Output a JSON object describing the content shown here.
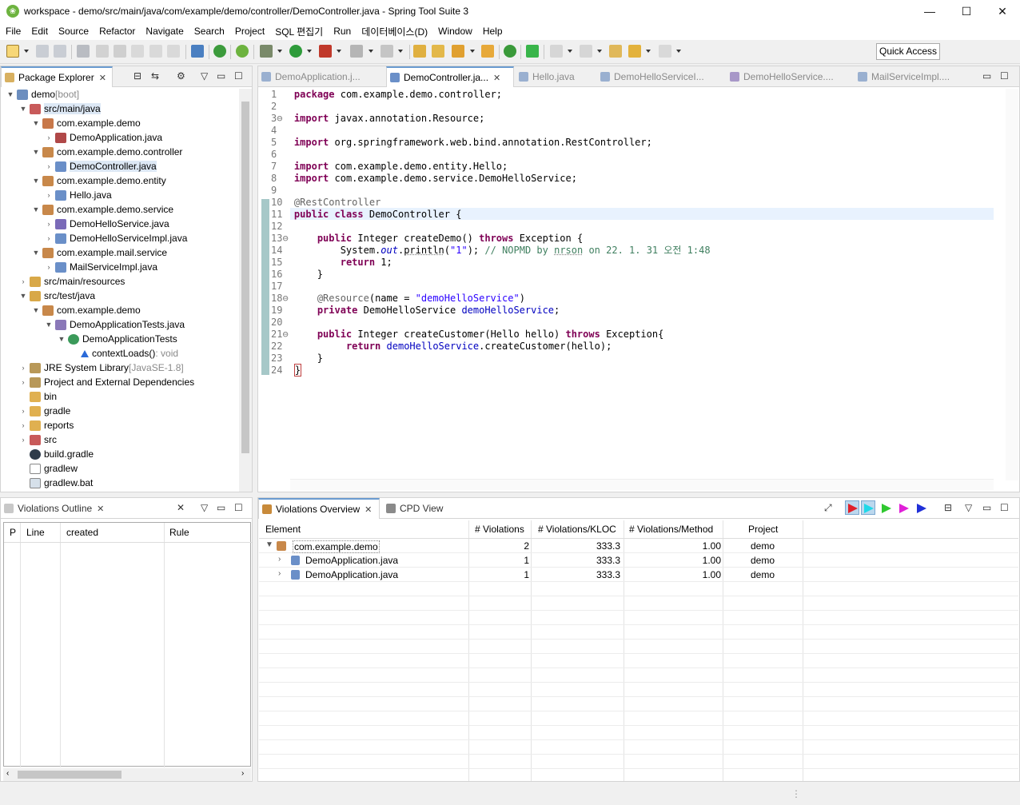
{
  "window": {
    "title": "workspace - demo/src/main/java/com/example/demo/controller/DemoController.java - Spring Tool Suite 3",
    "minimize": "—",
    "maximize": "☐",
    "close": "✕"
  },
  "menu": [
    "File",
    "Edit",
    "Source",
    "Refactor",
    "Navigate",
    "Search",
    "Project",
    "SQL 편집기",
    "Run",
    "데이터베이스(D)",
    "Window",
    "Help"
  ],
  "toolbar": {
    "quick_access": "Quick Access"
  },
  "package_explorer": {
    "title": "Package Explorer",
    "tree": [
      {
        "label": "demo",
        "suffix": " [boot]"
      },
      {
        "label": "src/main/java"
      },
      {
        "label": "com.example.demo"
      },
      {
        "label": "DemoApplication.java"
      },
      {
        "label": "com.example.demo.controller"
      },
      {
        "label": "DemoController.java"
      },
      {
        "label": "com.example.demo.entity"
      },
      {
        "label": "Hello.java"
      },
      {
        "label": "com.example.demo.service"
      },
      {
        "label": "DemoHelloService.java"
      },
      {
        "label": "DemoHelloServiceImpl.java"
      },
      {
        "label": "com.example.mail.service"
      },
      {
        "label": "MailServiceImpl.java"
      },
      {
        "label": "src/main/resources"
      },
      {
        "label": "src/test/java"
      },
      {
        "label": "com.example.demo"
      },
      {
        "label": "DemoApplicationTests.java"
      },
      {
        "label": "DemoApplicationTests"
      },
      {
        "label": "contextLoads()",
        "suffix": " : void"
      },
      {
        "label": "JRE System Library",
        "suffix": " [JavaSE-1.8]"
      },
      {
        "label": "Project and External Dependencies"
      },
      {
        "label": "bin"
      },
      {
        "label": "gradle"
      },
      {
        "label": "reports"
      },
      {
        "label": "src"
      },
      {
        "label": "build.gradle"
      },
      {
        "label": "gradlew"
      },
      {
        "label": "gradlew.bat"
      }
    ]
  },
  "editor": {
    "tabs": [
      "DemoApplication.j...",
      "DemoController.ja...",
      "Hello.java",
      "DemoHelloServiceI...",
      "DemoHelloService....",
      "MailServiceImpl...."
    ],
    "active_tab": 1
  },
  "violations_outline": {
    "title": "Violations Outline",
    "columns": [
      "P",
      "Line",
      "created",
      "Rule"
    ]
  },
  "violations_overview": {
    "tabs": [
      "Violations Overview",
      "CPD View"
    ],
    "columns": [
      "Element",
      "# Violations",
      "# Violations/KLOC",
      "# Violations/Method",
      "Project"
    ],
    "rows": [
      {
        "element": "com.example.demo",
        "violations": "2",
        "kloc": "333.3",
        "method": "1.00",
        "project": "demo"
      },
      {
        "element": "DemoApplication.java",
        "violations": "1",
        "kloc": "333.3",
        "method": "1.00",
        "project": "demo"
      },
      {
        "element": "DemoApplication.java",
        "violations": "1",
        "kloc": "333.3",
        "method": "1.00",
        "project": "demo"
      }
    ]
  },
  "colors": {
    "accent": "#6b9bd0",
    "keyword": "#7f0055",
    "string": "#2a00ff",
    "comment": "#3f7f5f",
    "field": "#0000c0"
  }
}
